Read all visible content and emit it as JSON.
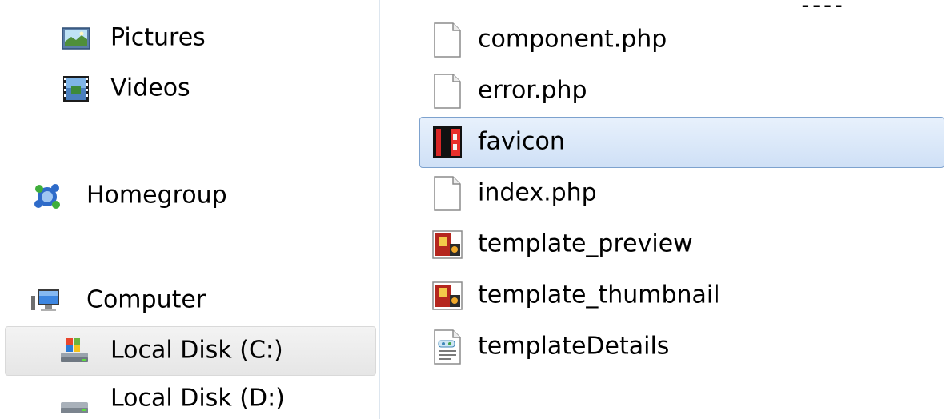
{
  "top_fragment": "ـ ـ ـ ـ",
  "navigation": {
    "items": [
      {
        "label": "Pictures",
        "icon": "pictures-library-icon"
      },
      {
        "label": "Videos",
        "icon": "videos-library-icon"
      },
      {
        "label": "Homegroup",
        "icon": "homegroup-icon"
      },
      {
        "label": "Computer",
        "icon": "computer-icon"
      },
      {
        "label": "Local Disk (C:)",
        "icon": "local-disk-c-icon",
        "selected": true
      },
      {
        "label": "Local Disk (D:)",
        "icon": "local-disk-d-icon"
      }
    ]
  },
  "files": [
    {
      "name": "component.php",
      "icon": "php-file-icon"
    },
    {
      "name": "error.php",
      "icon": "php-file-icon"
    },
    {
      "name": "favicon",
      "icon": "favicon-file-icon",
      "selected": true
    },
    {
      "name": "index.php",
      "icon": "php-file-icon"
    },
    {
      "name": "template_preview",
      "icon": "image-file-icon"
    },
    {
      "name": "template_thumbnail",
      "icon": "image-file-icon"
    },
    {
      "name": "templateDetails",
      "icon": "xml-file-icon"
    }
  ],
  "colors": {
    "selection_blue": "#cfe0f6",
    "selection_border": "#7da2ce",
    "nav_selection": "#e6e6e6"
  }
}
